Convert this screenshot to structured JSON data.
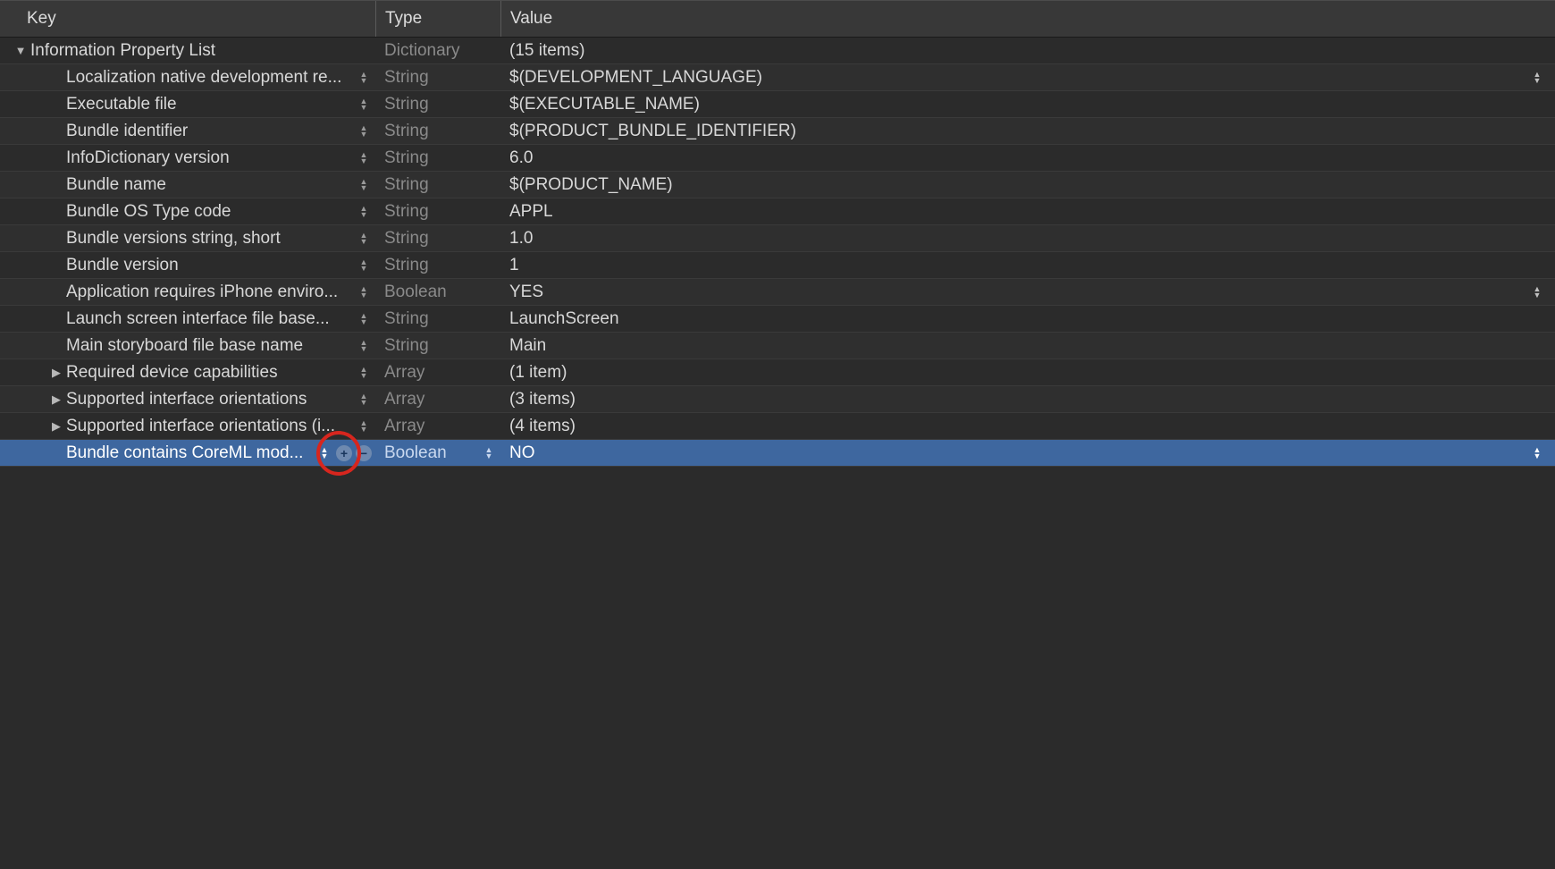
{
  "columns": {
    "key": "Key",
    "type": "Type",
    "value": "Value"
  },
  "rows": [
    {
      "key": "Information Property List",
      "type": "Dictionary",
      "value": "(15 items)",
      "indent": 0,
      "disclosure": "down",
      "keyStepper": false,
      "typeStepper": false,
      "valueStepper": false,
      "selected": false,
      "showAddRemove": false
    },
    {
      "key": "Localization native development re...",
      "type": "String",
      "value": "$(DEVELOPMENT_LANGUAGE)",
      "indent": 1,
      "disclosure": "none",
      "keyStepper": true,
      "typeStepper": false,
      "valueStepper": true,
      "selected": false,
      "showAddRemove": false
    },
    {
      "key": "Executable file",
      "type": "String",
      "value": "$(EXECUTABLE_NAME)",
      "indent": 1,
      "disclosure": "none",
      "keyStepper": true,
      "typeStepper": false,
      "valueStepper": false,
      "selected": false,
      "showAddRemove": false
    },
    {
      "key": "Bundle identifier",
      "type": "String",
      "value": "$(PRODUCT_BUNDLE_IDENTIFIER)",
      "indent": 1,
      "disclosure": "none",
      "keyStepper": true,
      "typeStepper": false,
      "valueStepper": false,
      "selected": false,
      "showAddRemove": false
    },
    {
      "key": "InfoDictionary version",
      "type": "String",
      "value": "6.0",
      "indent": 1,
      "disclosure": "none",
      "keyStepper": true,
      "typeStepper": false,
      "valueStepper": false,
      "selected": false,
      "showAddRemove": false
    },
    {
      "key": "Bundle name",
      "type": "String",
      "value": "$(PRODUCT_NAME)",
      "indent": 1,
      "disclosure": "none",
      "keyStepper": true,
      "typeStepper": false,
      "valueStepper": false,
      "selected": false,
      "showAddRemove": false
    },
    {
      "key": "Bundle OS Type code",
      "type": "String",
      "value": "APPL",
      "indent": 1,
      "disclosure": "none",
      "keyStepper": true,
      "typeStepper": false,
      "valueStepper": false,
      "selected": false,
      "showAddRemove": false
    },
    {
      "key": "Bundle versions string, short",
      "type": "String",
      "value": "1.0",
      "indent": 1,
      "disclosure": "none",
      "keyStepper": true,
      "typeStepper": false,
      "valueStepper": false,
      "selected": false,
      "showAddRemove": false
    },
    {
      "key": "Bundle version",
      "type": "String",
      "value": "1",
      "indent": 1,
      "disclosure": "none",
      "keyStepper": true,
      "typeStepper": false,
      "valueStepper": false,
      "selected": false,
      "showAddRemove": false
    },
    {
      "key": "Application requires iPhone enviro...",
      "type": "Boolean",
      "value": "YES",
      "indent": 1,
      "disclosure": "none",
      "keyStepper": true,
      "typeStepper": false,
      "valueStepper": true,
      "selected": false,
      "showAddRemove": false
    },
    {
      "key": "Launch screen interface file base...",
      "type": "String",
      "value": "LaunchScreen",
      "indent": 1,
      "disclosure": "none",
      "keyStepper": true,
      "typeStepper": false,
      "valueStepper": false,
      "selected": false,
      "showAddRemove": false
    },
    {
      "key": "Main storyboard file base name",
      "type": "String",
      "value": "Main",
      "indent": 1,
      "disclosure": "none",
      "keyStepper": true,
      "typeStepper": false,
      "valueStepper": false,
      "selected": false,
      "showAddRemove": false
    },
    {
      "key": "Required device capabilities",
      "type": "Array",
      "value": "(1 item)",
      "indent": 1,
      "disclosure": "right",
      "keyStepper": true,
      "typeStepper": false,
      "valueStepper": false,
      "selected": false,
      "showAddRemove": false
    },
    {
      "key": "Supported interface orientations",
      "type": "Array",
      "value": "(3 items)",
      "indent": 1,
      "disclosure": "right",
      "keyStepper": true,
      "typeStepper": false,
      "valueStepper": false,
      "selected": false,
      "showAddRemove": false
    },
    {
      "key": "Supported interface orientations (i...",
      "type": "Array",
      "value": "(4 items)",
      "indent": 1,
      "disclosure": "right",
      "keyStepper": true,
      "typeStepper": false,
      "valueStepper": false,
      "selected": false,
      "showAddRemove": false
    },
    {
      "key": "Bundle contains CoreML mod...",
      "type": "Boolean",
      "value": "NO",
      "indent": 1,
      "disclosure": "none",
      "keyStepper": true,
      "typeStepper": true,
      "valueStepper": true,
      "selected": true,
      "showAddRemove": true
    }
  ],
  "annotation": {
    "circle_on_row_index": 15
  }
}
